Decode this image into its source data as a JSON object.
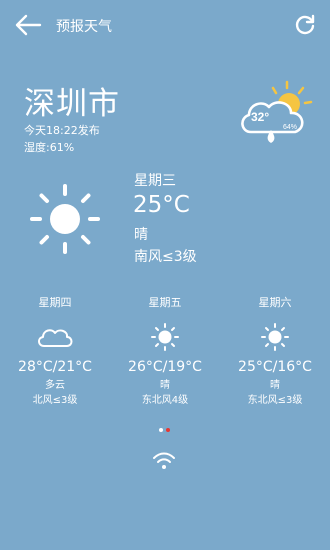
{
  "header": {
    "title": "预报天气"
  },
  "current": {
    "city": "深圳市",
    "published": "今天18:22发布",
    "humidity": "湿度:61%",
    "badge_temp": "32°",
    "badge_humidity": "64%"
  },
  "today": {
    "day": "星期三",
    "temp": "25°C",
    "condition": "晴",
    "wind": "南风≤3级",
    "icon": "sun-icon"
  },
  "forecast": [
    {
      "day": "星期四",
      "temp": "28°C/21°C",
      "condition": "多云",
      "wind": "北风≤3级",
      "icon": "cloud-icon"
    },
    {
      "day": "星期五",
      "temp": "26°C/19°C",
      "condition": "晴",
      "wind": "东北风4级",
      "icon": "sun-icon"
    },
    {
      "day": "星期六",
      "temp": "25°C/16°C",
      "condition": "晴",
      "wind": "东北风≤3级",
      "icon": "sun-icon"
    }
  ],
  "pager": {
    "active_index": 1,
    "count": 2
  },
  "colors": {
    "background": "#7ba9cb",
    "text": "#ffffff",
    "sun": "#f5c542",
    "badge_drop": "#6fb3e6",
    "pager_active": "#e53935"
  }
}
